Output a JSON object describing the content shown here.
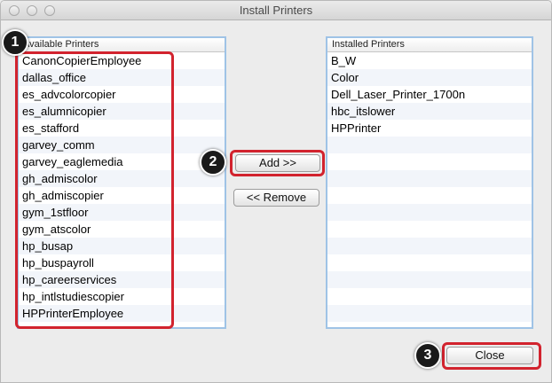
{
  "window": {
    "title": "Install Printers"
  },
  "available": {
    "header": "Available Printers",
    "items": [
      "CanonCopierEmployee",
      "dallas_office",
      "es_advcolorcopier",
      "es_alumnicopier",
      "es_stafford",
      "garvey_comm",
      "garvey_eaglemedia",
      "gh_admiscolor",
      "gh_admiscopier",
      "gym_1stfloor",
      "gym_atscolor",
      "hp_busap",
      "hp_buspayroll",
      "hp_careerservices",
      "hp_intlstudiescopier",
      "HPPrinterEmployee"
    ]
  },
  "installed": {
    "header": "Installed Printers",
    "items": [
      "B_W",
      "Color",
      "Dell_Laser_Printer_1700n",
      "hbc_itslower",
      "HPPrinter"
    ]
  },
  "buttons": {
    "add": "Add >>",
    "remove": "<< Remove",
    "close": "Close"
  },
  "badges": [
    "1",
    "2",
    "3"
  ],
  "colors": {
    "highlight": "#d2232e",
    "list_border": "#9fc3e6",
    "badge": "#1a1a1a"
  }
}
